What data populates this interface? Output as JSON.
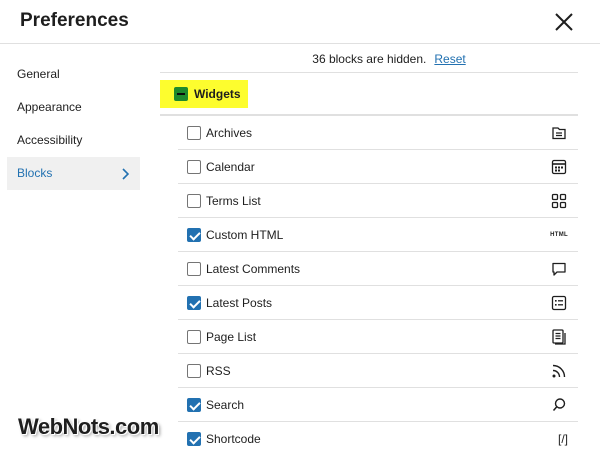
{
  "dialog": {
    "title": "Preferences",
    "close_label": "Close"
  },
  "sidebar": {
    "items": [
      {
        "label": "General"
      },
      {
        "label": "Appearance"
      },
      {
        "label": "Accessibility"
      },
      {
        "label": "Blocks",
        "active": true
      }
    ]
  },
  "blocks": {
    "hidden_text": "36 blocks are hidden.",
    "reset_label": "Reset",
    "category": {
      "label": "Widgets",
      "state": "indeterminate"
    },
    "items": [
      {
        "label": "Archives",
        "checked": false,
        "icon": "archives-icon"
      },
      {
        "label": "Calendar",
        "checked": false,
        "icon": "calendar-icon"
      },
      {
        "label": "Terms List",
        "checked": false,
        "icon": "categories-grid-icon"
      },
      {
        "label": "Custom HTML",
        "checked": true,
        "icon": "html-icon",
        "icon_text": "HTML"
      },
      {
        "label": "Latest Comments",
        "checked": false,
        "icon": "comment-icon"
      },
      {
        "label": "Latest Posts",
        "checked": true,
        "icon": "post-list-icon"
      },
      {
        "label": "Page List",
        "checked": false,
        "icon": "pages-icon"
      },
      {
        "label": "RSS",
        "checked": false,
        "icon": "rss-icon"
      },
      {
        "label": "Search",
        "checked": true,
        "icon": "search-icon"
      },
      {
        "label": "Shortcode",
        "checked": true,
        "icon": "shortcode-icon",
        "icon_text": "[/]"
      }
    ]
  },
  "watermark": {
    "text": "WebNots.com"
  },
  "colors": {
    "accent": "#2271b1",
    "highlight": "#fdfd2e",
    "category_check": "#1f8a2c"
  }
}
